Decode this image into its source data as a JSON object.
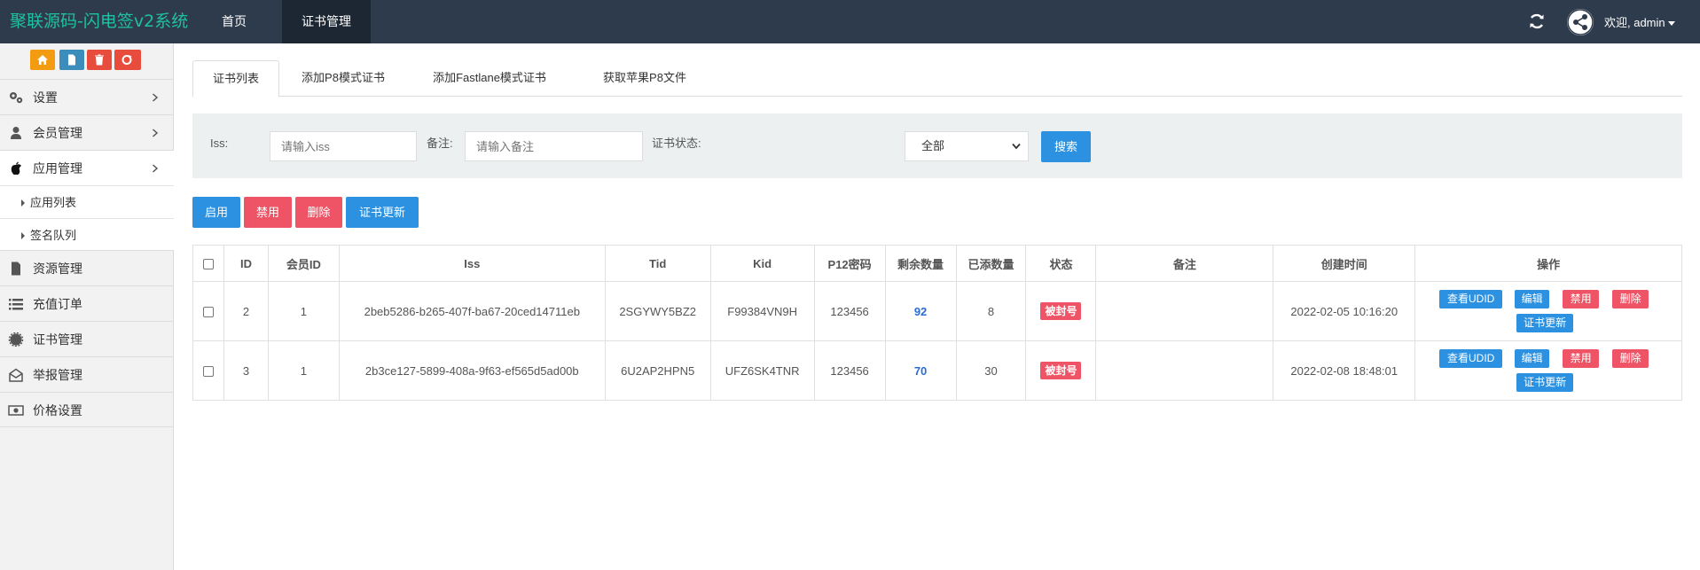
{
  "header": {
    "brand": "聚联源码-闪电签v2系统",
    "nav": {
      "home": "首页",
      "cert": "证书管理"
    },
    "welcome": "欢迎, admin"
  },
  "sidebar": {
    "quick_buttons": [
      "home-icon",
      "file-icon",
      "trash-icon",
      "recycle-icon"
    ],
    "items": [
      {
        "label": "设置",
        "icon": "gears-icon"
      },
      {
        "label": "会员管理",
        "icon": "user-icon"
      },
      {
        "label": "应用管理",
        "icon": "apple-icon"
      },
      {
        "label": "资源管理",
        "icon": "file-icon"
      },
      {
        "label": "充值订单",
        "icon": "list-icon"
      },
      {
        "label": "证书管理",
        "icon": "cert-gear-icon"
      },
      {
        "label": "举报管理",
        "icon": "envelope-open-icon"
      },
      {
        "label": "价格设置",
        "icon": "money-icon"
      }
    ],
    "sub_items": [
      "应用列表",
      "签名队列"
    ]
  },
  "tabs": [
    "证书列表",
    "添加P8模式证书",
    "添加Fastlane模式证书",
    "获取苹果P8文件"
  ],
  "search": {
    "iss_label": "Iss:",
    "iss_placeholder": "请输入iss",
    "remark_label": "备注:",
    "remark_placeholder": "请输入备注",
    "status_label": "证书状态:",
    "status_value": "全部",
    "button": "搜索"
  },
  "actions": {
    "enable": "启用",
    "disable": "禁用",
    "delete": "删除",
    "update": "证书更新"
  },
  "table": {
    "headers": [
      "ID",
      "会员ID",
      "Iss",
      "Tid",
      "Kid",
      "P12密码",
      "剩余数量",
      "已添数量",
      "状态",
      "备注",
      "创建时间",
      "操作"
    ],
    "rows": [
      {
        "id": "2",
        "member_id": "1",
        "iss": "2beb5286-b265-407f-ba67-20ced14711eb",
        "tid": "2SGYWY5BZ2",
        "kid": "F99384VN9H",
        "p12": "123456",
        "remaining": "92",
        "added": "8",
        "status": "被封号",
        "remark": "",
        "created": "2022-02-05 10:16:20"
      },
      {
        "id": "3",
        "member_id": "1",
        "iss": "2b3ce127-5899-408a-9f63-ef565d5ad00b",
        "tid": "6U2AP2HPN5",
        "kid": "UFZ6SK4TNR",
        "p12": "123456",
        "remaining": "70",
        "added": "30",
        "status": "被封号",
        "remark": "",
        "created": "2022-02-08 18:48:01"
      }
    ],
    "ops": {
      "view_udid": "查看UDID",
      "edit": "编辑",
      "disable": "禁用",
      "delete": "删除",
      "update": "证书更新"
    }
  },
  "colors": {
    "topbar": "#2e3b4c",
    "brand": "#1fc0a4",
    "primary": "#2c91e0",
    "danger": "#ef5466"
  }
}
